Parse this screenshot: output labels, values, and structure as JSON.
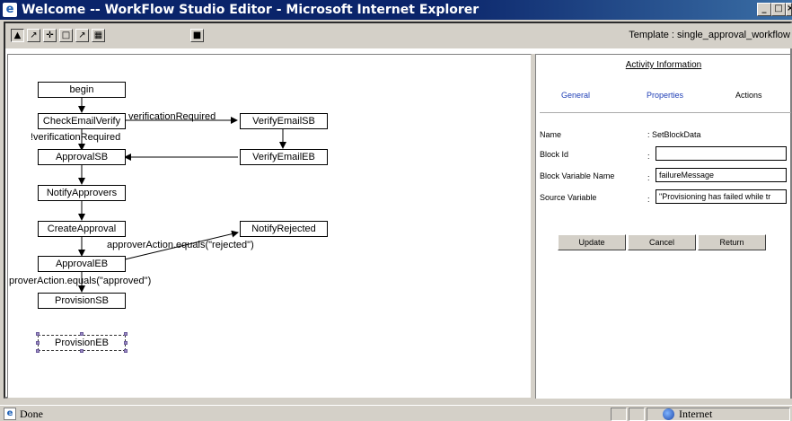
{
  "window": {
    "title": "Welcome -- WorkFlow Studio Editor - Microsoft Internet Explorer",
    "controls": {
      "minimize_icon": "minimize-icon",
      "maximize_icon": "maximize-icon",
      "close_icon": "close-icon"
    }
  },
  "toolbar": {
    "tools": [
      "select-arrow-icon",
      "link-arrow-icon",
      "move-icon",
      "add-block-icon",
      "connect-icon",
      "delete-icon"
    ],
    "save_icon": "save-icon",
    "template_label": "Template : single_approval_workflow"
  },
  "diagram": {
    "nodes": {
      "begin": "begin",
      "checkemailverify": "CheckEmailVerify",
      "verifyemailsb": "VerifyEmailSB",
      "approvalsb": "ApprovalSB",
      "verifyemaileb": "VerifyEmailEB",
      "notifyapprovers": "NotifyApprovers",
      "createapproval": "CreateApproval",
      "notifyrejected": "NotifyRejected",
      "approvaleb": "ApprovalEB",
      "provisionsb": "ProvisionSB",
      "provisioneb": "ProvisionEB"
    },
    "edge_labels": {
      "verification_required": "verificationRequired",
      "not_verification_required": "!verificationRequired",
      "rejected": "approverAction.equals(\"rejected\")",
      "approved": "proverAction.equals(\"approved\")"
    }
  },
  "panel": {
    "title": "Activity Information",
    "tabs": {
      "general": "General",
      "properties": "Properties",
      "actions": "Actions"
    },
    "fields": {
      "name_label": "Name",
      "name_value": ": SetBlockData",
      "block_id_label": "Block Id",
      "block_id_value": "",
      "block_var_label": "Block Variable Name",
      "block_var_value": "failureMessage",
      "source_var_label": "Source Variable",
      "source_var_value": "\"Provisioning has failed while tr",
      "colon": ":"
    },
    "buttons": {
      "update": "Update",
      "cancel": "Cancel",
      "return": "Return"
    }
  },
  "statusbar": {
    "text": "Done",
    "zone": "Internet"
  },
  "colors": {
    "titlebar": "#0a246a",
    "chrome": "#d4d0c8",
    "active_tab": "#1d3db5"
  }
}
